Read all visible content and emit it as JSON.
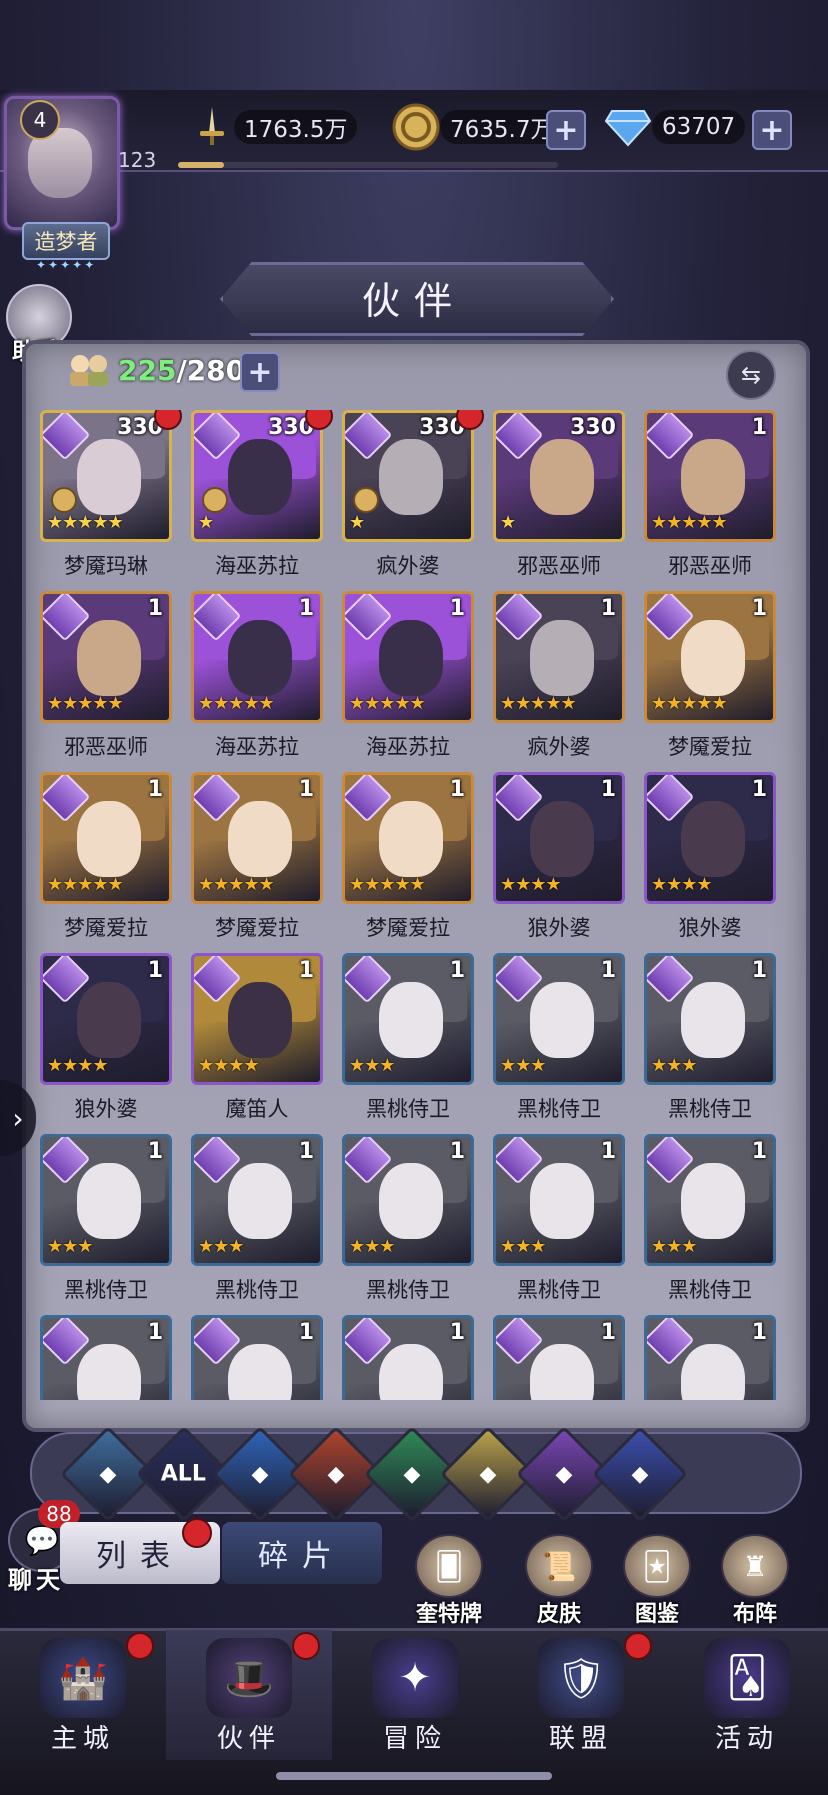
{
  "player": {
    "level": "4",
    "exp_value": "123",
    "exp_fraction": 0.12,
    "title": "造梦者",
    "title_stars": "✦✦✦✦✦"
  },
  "resources": {
    "power": "1763.5万",
    "gold": "7635.7万",
    "diamond": "63707"
  },
  "helper": {
    "label": "助手"
  },
  "header": {
    "title": "伙伴"
  },
  "roster": {
    "current": "225",
    "max": "/280"
  },
  "heroes": [
    {
      "name": "梦魇玛琳",
      "level": "330",
      "stars": 5,
      "star_style": "gold",
      "frame": "gold",
      "red_dot": true,
      "locked": true,
      "palette": [
        "#d9ccd4",
        "#7b7388"
      ]
    },
    {
      "name": "海巫苏拉",
      "level": "330",
      "stars": 1,
      "star_style": "gold",
      "frame": "gold",
      "red_dot": true,
      "locked": true,
      "palette": [
        "#3a2f4a",
        "#9c52d8"
      ]
    },
    {
      "name": "疯外婆",
      "level": "330",
      "stars": 1,
      "star_style": "gold",
      "frame": "gold",
      "red_dot": true,
      "locked": true,
      "palette": [
        "#b5aeb5",
        "#4a4356"
      ]
    },
    {
      "name": "邪恶巫师",
      "level": "330",
      "stars": 1,
      "star_style": "gold",
      "frame": "gold",
      "red_dot": false,
      "locked": false,
      "palette": [
        "#c8a888",
        "#5b3a7a"
      ]
    },
    {
      "name": "邪恶巫师",
      "level": "1",
      "stars": 5,
      "star_style": "orange",
      "frame": "orange",
      "red_dot": false,
      "locked": false,
      "palette": [
        "#c8a888",
        "#5b3a7a"
      ]
    },
    {
      "name": "邪恶巫师",
      "level": "1",
      "stars": 5,
      "star_style": "orange",
      "frame": "orange",
      "red_dot": false,
      "locked": false,
      "palette": [
        "#c8a888",
        "#5b3a7a"
      ]
    },
    {
      "name": "海巫苏拉",
      "level": "1",
      "stars": 5,
      "star_style": "orange",
      "frame": "orange",
      "red_dot": false,
      "locked": false,
      "palette": [
        "#3a2f4a",
        "#9c52d8"
      ]
    },
    {
      "name": "海巫苏拉",
      "level": "1",
      "stars": 5,
      "star_style": "orange",
      "frame": "orange",
      "red_dot": false,
      "locked": false,
      "palette": [
        "#3a2f4a",
        "#9c52d8"
      ]
    },
    {
      "name": "疯外婆",
      "level": "1",
      "stars": 5,
      "star_style": "orange",
      "frame": "orange",
      "red_dot": false,
      "locked": false,
      "palette": [
        "#b5aeb5",
        "#4a4356"
      ]
    },
    {
      "name": "梦魇爱拉",
      "level": "1",
      "stars": 5,
      "star_style": "orange",
      "frame": "orange",
      "red_dot": false,
      "locked": false,
      "palette": [
        "#f0dcc6",
        "#9c7442"
      ]
    },
    {
      "name": "梦魇爱拉",
      "level": "1",
      "stars": 5,
      "star_style": "orange",
      "frame": "orange",
      "red_dot": false,
      "locked": false,
      "palette": [
        "#f0dcc6",
        "#9c7442"
      ]
    },
    {
      "name": "梦魇爱拉",
      "level": "1",
      "stars": 5,
      "star_style": "orange",
      "frame": "orange",
      "red_dot": false,
      "locked": false,
      "palette": [
        "#f0dcc6",
        "#9c7442"
      ]
    },
    {
      "name": "梦魇爱拉",
      "level": "1",
      "stars": 5,
      "star_style": "orange",
      "frame": "orange",
      "red_dot": false,
      "locked": false,
      "palette": [
        "#f0dcc6",
        "#9c7442"
      ]
    },
    {
      "name": "狼外婆",
      "level": "1",
      "stars": 4,
      "star_style": "orange",
      "frame": "purple",
      "red_dot": false,
      "locked": false,
      "palette": [
        "#4a3a4e",
        "#2e2a4a"
      ]
    },
    {
      "name": "狼外婆",
      "level": "1",
      "stars": 4,
      "star_style": "orange",
      "frame": "purple",
      "red_dot": false,
      "locked": false,
      "palette": [
        "#4a3a4e",
        "#2e2a4a"
      ]
    },
    {
      "name": "狼外婆",
      "level": "1",
      "stars": 4,
      "star_style": "orange",
      "frame": "purple",
      "red_dot": false,
      "locked": false,
      "palette": [
        "#4a3a4e",
        "#2e2a4a"
      ]
    },
    {
      "name": "魔笛人",
      "level": "1",
      "stars": 4,
      "star_style": "orange",
      "frame": "purple",
      "red_dot": false,
      "locked": false,
      "palette": [
        "#3b3046",
        "#b08a3a"
      ]
    },
    {
      "name": "黑桃侍卫",
      "level": "1",
      "stars": 3,
      "star_style": "orange",
      "frame": "blue",
      "red_dot": false,
      "locked": false,
      "palette": [
        "#e8e4ea",
        "#5b5b66"
      ]
    },
    {
      "name": "黑桃侍卫",
      "level": "1",
      "stars": 3,
      "star_style": "orange",
      "frame": "blue",
      "red_dot": false,
      "locked": false,
      "palette": [
        "#e8e4ea",
        "#5b5b66"
      ]
    },
    {
      "name": "黑桃侍卫",
      "level": "1",
      "stars": 3,
      "star_style": "orange",
      "frame": "blue",
      "red_dot": false,
      "locked": false,
      "palette": [
        "#e8e4ea",
        "#5b5b66"
      ]
    },
    {
      "name": "黑桃侍卫",
      "level": "1",
      "stars": 3,
      "star_style": "orange",
      "frame": "blue",
      "red_dot": false,
      "locked": false,
      "palette": [
        "#e8e4ea",
        "#5b5b66"
      ]
    },
    {
      "name": "黑桃侍卫",
      "level": "1",
      "stars": 3,
      "star_style": "orange",
      "frame": "blue",
      "red_dot": false,
      "locked": false,
      "palette": [
        "#e8e4ea",
        "#5b5b66"
      ]
    },
    {
      "name": "黑桃侍卫",
      "level": "1",
      "stars": 3,
      "star_style": "orange",
      "frame": "blue",
      "red_dot": false,
      "locked": false,
      "palette": [
        "#e8e4ea",
        "#5b5b66"
      ]
    },
    {
      "name": "黑桃侍卫",
      "level": "1",
      "stars": 3,
      "star_style": "orange",
      "frame": "blue",
      "red_dot": false,
      "locked": false,
      "palette": [
        "#e8e4ea",
        "#5b5b66"
      ]
    },
    {
      "name": "黑桃侍卫",
      "level": "1",
      "stars": 3,
      "star_style": "orange",
      "frame": "blue",
      "red_dot": false,
      "locked": false,
      "palette": [
        "#e8e4ea",
        "#5b5b66"
      ]
    },
    {
      "name": "",
      "level": "1",
      "stars": 0,
      "star_style": "orange",
      "frame": "blue",
      "red_dot": false,
      "locked": false,
      "palette": [
        "#e8e4ea",
        "#5b5b66"
      ]
    },
    {
      "name": "",
      "level": "1",
      "stars": 0,
      "star_style": "orange",
      "frame": "blue",
      "red_dot": false,
      "locked": false,
      "palette": [
        "#e8e4ea",
        "#5b5b66"
      ]
    },
    {
      "name": "",
      "level": "1",
      "stars": 0,
      "star_style": "orange",
      "frame": "blue",
      "red_dot": false,
      "locked": false,
      "palette": [
        "#e8e4ea",
        "#5b5b66"
      ]
    },
    {
      "name": "",
      "level": "1",
      "stars": 0,
      "star_style": "orange",
      "frame": "blue",
      "red_dot": false,
      "locked": false,
      "palette": [
        "#e8e4ea",
        "#5b5b66"
      ]
    },
    {
      "name": "",
      "level": "1",
      "stars": 0,
      "star_style": "orange",
      "frame": "blue",
      "red_dot": false,
      "locked": false,
      "palette": [
        "#e8e4ea",
        "#5b5b66"
      ]
    }
  ],
  "filters": [
    {
      "icon": "all-up-icon",
      "label": "",
      "color": "#3f6e9e"
    },
    {
      "icon": "all-text-icon",
      "label": "ALL",
      "color": "#2a2f5a"
    },
    {
      "icon": "water-icon",
      "label": "",
      "color": "#2f64b8"
    },
    {
      "icon": "fire-icon",
      "label": "",
      "color": "#b0442c"
    },
    {
      "icon": "wind-icon",
      "label": "",
      "color": "#2e8a56"
    },
    {
      "icon": "light-icon",
      "label": "",
      "color": "#b9a24a"
    },
    {
      "icon": "dark-moon-icon",
      "label": "",
      "color": "#7a46b4"
    },
    {
      "icon": "cosmic-icon",
      "label": "",
      "color": "#3b4fae"
    }
  ],
  "sub_tabs": {
    "list": "列表",
    "fragments": "碎片"
  },
  "chat": {
    "label": "聊天",
    "count": "88"
  },
  "quick_actions": [
    {
      "label": "奎特牌"
    },
    {
      "label": "皮肤"
    },
    {
      "label": "图鉴"
    },
    {
      "label": "布阵"
    }
  ],
  "nav": [
    {
      "label": "主城",
      "red_dot": true,
      "active": false
    },
    {
      "label": "伙伴",
      "red_dot": true,
      "active": true
    },
    {
      "label": "冒险",
      "red_dot": false,
      "active": false
    },
    {
      "label": "联盟",
      "red_dot": true,
      "active": false
    },
    {
      "label": "活动",
      "red_dot": false,
      "active": false
    }
  ]
}
